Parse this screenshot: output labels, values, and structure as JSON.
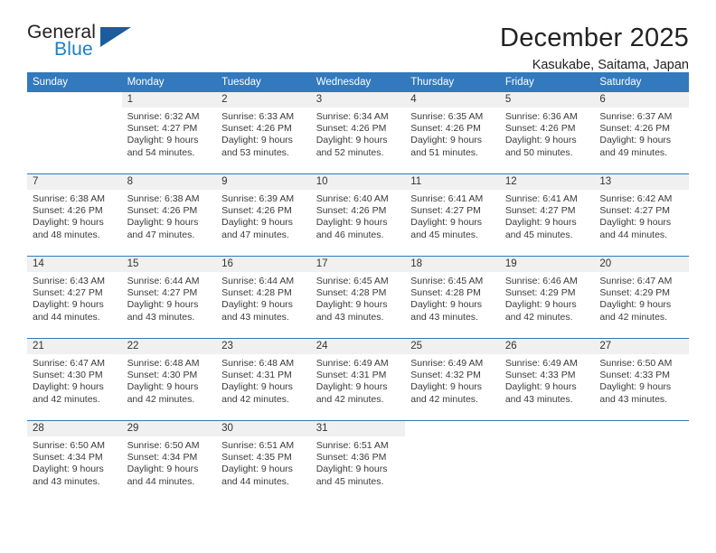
{
  "brand": {
    "name_part1": "General",
    "name_part2": "Blue",
    "accent_color": "#1d7ec8",
    "triangle_color": "#1b5c9e"
  },
  "header": {
    "title": "December 2025",
    "subtitle": "Kasukabe, Saitama, Japan"
  },
  "calendar": {
    "header_color": "#3279bd",
    "weekdays": [
      "Sunday",
      "Monday",
      "Tuesday",
      "Wednesday",
      "Thursday",
      "Friday",
      "Saturday"
    ],
    "weeks": [
      [
        {
          "day": "",
          "sunrise": "",
          "sunset": "",
          "daylight1": "",
          "daylight2": ""
        },
        {
          "day": "1",
          "sunrise": "Sunrise: 6:32 AM",
          "sunset": "Sunset: 4:27 PM",
          "daylight1": "Daylight: 9 hours",
          "daylight2": "and 54 minutes."
        },
        {
          "day": "2",
          "sunrise": "Sunrise: 6:33 AM",
          "sunset": "Sunset: 4:26 PM",
          "daylight1": "Daylight: 9 hours",
          "daylight2": "and 53 minutes."
        },
        {
          "day": "3",
          "sunrise": "Sunrise: 6:34 AM",
          "sunset": "Sunset: 4:26 PM",
          "daylight1": "Daylight: 9 hours",
          "daylight2": "and 52 minutes."
        },
        {
          "day": "4",
          "sunrise": "Sunrise: 6:35 AM",
          "sunset": "Sunset: 4:26 PM",
          "daylight1": "Daylight: 9 hours",
          "daylight2": "and 51 minutes."
        },
        {
          "day": "5",
          "sunrise": "Sunrise: 6:36 AM",
          "sunset": "Sunset: 4:26 PM",
          "daylight1": "Daylight: 9 hours",
          "daylight2": "and 50 minutes."
        },
        {
          "day": "6",
          "sunrise": "Sunrise: 6:37 AM",
          "sunset": "Sunset: 4:26 PM",
          "daylight1": "Daylight: 9 hours",
          "daylight2": "and 49 minutes."
        }
      ],
      [
        {
          "day": "7",
          "sunrise": "Sunrise: 6:38 AM",
          "sunset": "Sunset: 4:26 PM",
          "daylight1": "Daylight: 9 hours",
          "daylight2": "and 48 minutes."
        },
        {
          "day": "8",
          "sunrise": "Sunrise: 6:38 AM",
          "sunset": "Sunset: 4:26 PM",
          "daylight1": "Daylight: 9 hours",
          "daylight2": "and 47 minutes."
        },
        {
          "day": "9",
          "sunrise": "Sunrise: 6:39 AM",
          "sunset": "Sunset: 4:26 PM",
          "daylight1": "Daylight: 9 hours",
          "daylight2": "and 47 minutes."
        },
        {
          "day": "10",
          "sunrise": "Sunrise: 6:40 AM",
          "sunset": "Sunset: 4:26 PM",
          "daylight1": "Daylight: 9 hours",
          "daylight2": "and 46 minutes."
        },
        {
          "day": "11",
          "sunrise": "Sunrise: 6:41 AM",
          "sunset": "Sunset: 4:27 PM",
          "daylight1": "Daylight: 9 hours",
          "daylight2": "and 45 minutes."
        },
        {
          "day": "12",
          "sunrise": "Sunrise: 6:41 AM",
          "sunset": "Sunset: 4:27 PM",
          "daylight1": "Daylight: 9 hours",
          "daylight2": "and 45 minutes."
        },
        {
          "day": "13",
          "sunrise": "Sunrise: 6:42 AM",
          "sunset": "Sunset: 4:27 PM",
          "daylight1": "Daylight: 9 hours",
          "daylight2": "and 44 minutes."
        }
      ],
      [
        {
          "day": "14",
          "sunrise": "Sunrise: 6:43 AM",
          "sunset": "Sunset: 4:27 PM",
          "daylight1": "Daylight: 9 hours",
          "daylight2": "and 44 minutes."
        },
        {
          "day": "15",
          "sunrise": "Sunrise: 6:44 AM",
          "sunset": "Sunset: 4:27 PM",
          "daylight1": "Daylight: 9 hours",
          "daylight2": "and 43 minutes."
        },
        {
          "day": "16",
          "sunrise": "Sunrise: 6:44 AM",
          "sunset": "Sunset: 4:28 PM",
          "daylight1": "Daylight: 9 hours",
          "daylight2": "and 43 minutes."
        },
        {
          "day": "17",
          "sunrise": "Sunrise: 6:45 AM",
          "sunset": "Sunset: 4:28 PM",
          "daylight1": "Daylight: 9 hours",
          "daylight2": "and 43 minutes."
        },
        {
          "day": "18",
          "sunrise": "Sunrise: 6:45 AM",
          "sunset": "Sunset: 4:28 PM",
          "daylight1": "Daylight: 9 hours",
          "daylight2": "and 43 minutes."
        },
        {
          "day": "19",
          "sunrise": "Sunrise: 6:46 AM",
          "sunset": "Sunset: 4:29 PM",
          "daylight1": "Daylight: 9 hours",
          "daylight2": "and 42 minutes."
        },
        {
          "day": "20",
          "sunrise": "Sunrise: 6:47 AM",
          "sunset": "Sunset: 4:29 PM",
          "daylight1": "Daylight: 9 hours",
          "daylight2": "and 42 minutes."
        }
      ],
      [
        {
          "day": "21",
          "sunrise": "Sunrise: 6:47 AM",
          "sunset": "Sunset: 4:30 PM",
          "daylight1": "Daylight: 9 hours",
          "daylight2": "and 42 minutes."
        },
        {
          "day": "22",
          "sunrise": "Sunrise: 6:48 AM",
          "sunset": "Sunset: 4:30 PM",
          "daylight1": "Daylight: 9 hours",
          "daylight2": "and 42 minutes."
        },
        {
          "day": "23",
          "sunrise": "Sunrise: 6:48 AM",
          "sunset": "Sunset: 4:31 PM",
          "daylight1": "Daylight: 9 hours",
          "daylight2": "and 42 minutes."
        },
        {
          "day": "24",
          "sunrise": "Sunrise: 6:49 AM",
          "sunset": "Sunset: 4:31 PM",
          "daylight1": "Daylight: 9 hours",
          "daylight2": "and 42 minutes."
        },
        {
          "day": "25",
          "sunrise": "Sunrise: 6:49 AM",
          "sunset": "Sunset: 4:32 PM",
          "daylight1": "Daylight: 9 hours",
          "daylight2": "and 42 minutes."
        },
        {
          "day": "26",
          "sunrise": "Sunrise: 6:49 AM",
          "sunset": "Sunset: 4:33 PM",
          "daylight1": "Daylight: 9 hours",
          "daylight2": "and 43 minutes."
        },
        {
          "day": "27",
          "sunrise": "Sunrise: 6:50 AM",
          "sunset": "Sunset: 4:33 PM",
          "daylight1": "Daylight: 9 hours",
          "daylight2": "and 43 minutes."
        }
      ],
      [
        {
          "day": "28",
          "sunrise": "Sunrise: 6:50 AM",
          "sunset": "Sunset: 4:34 PM",
          "daylight1": "Daylight: 9 hours",
          "daylight2": "and 43 minutes."
        },
        {
          "day": "29",
          "sunrise": "Sunrise: 6:50 AM",
          "sunset": "Sunset: 4:34 PM",
          "daylight1": "Daylight: 9 hours",
          "daylight2": "and 44 minutes."
        },
        {
          "day": "30",
          "sunrise": "Sunrise: 6:51 AM",
          "sunset": "Sunset: 4:35 PM",
          "daylight1": "Daylight: 9 hours",
          "daylight2": "and 44 minutes."
        },
        {
          "day": "31",
          "sunrise": "Sunrise: 6:51 AM",
          "sunset": "Sunset: 4:36 PM",
          "daylight1": "Daylight: 9 hours",
          "daylight2": "and 45 minutes."
        },
        {
          "day": "",
          "sunrise": "",
          "sunset": "",
          "daylight1": "",
          "daylight2": ""
        },
        {
          "day": "",
          "sunrise": "",
          "sunset": "",
          "daylight1": "",
          "daylight2": ""
        },
        {
          "day": "",
          "sunrise": "",
          "sunset": "",
          "daylight1": "",
          "daylight2": ""
        }
      ]
    ]
  }
}
